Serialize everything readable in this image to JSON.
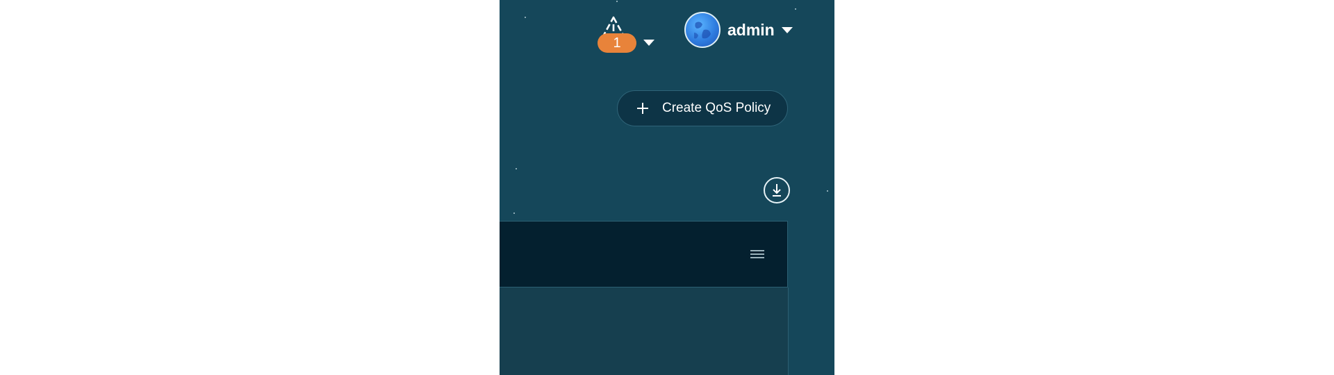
{
  "header": {
    "alerts": {
      "count": "1",
      "icon": "warning-triangle-icon",
      "badge_color": "#e8833a"
    },
    "user": {
      "name": "admin",
      "avatar_icon": "user-avatar-icon"
    }
  },
  "actions": {
    "create_button_label": "Create QoS Policy",
    "create_icon": "plus-icon",
    "download_icon": "download-icon"
  },
  "table": {
    "menu_icon": "hamburger-menu-icon"
  },
  "colors": {
    "background": "#15475a",
    "table_header": "#04202f",
    "button": "#0d3446"
  }
}
